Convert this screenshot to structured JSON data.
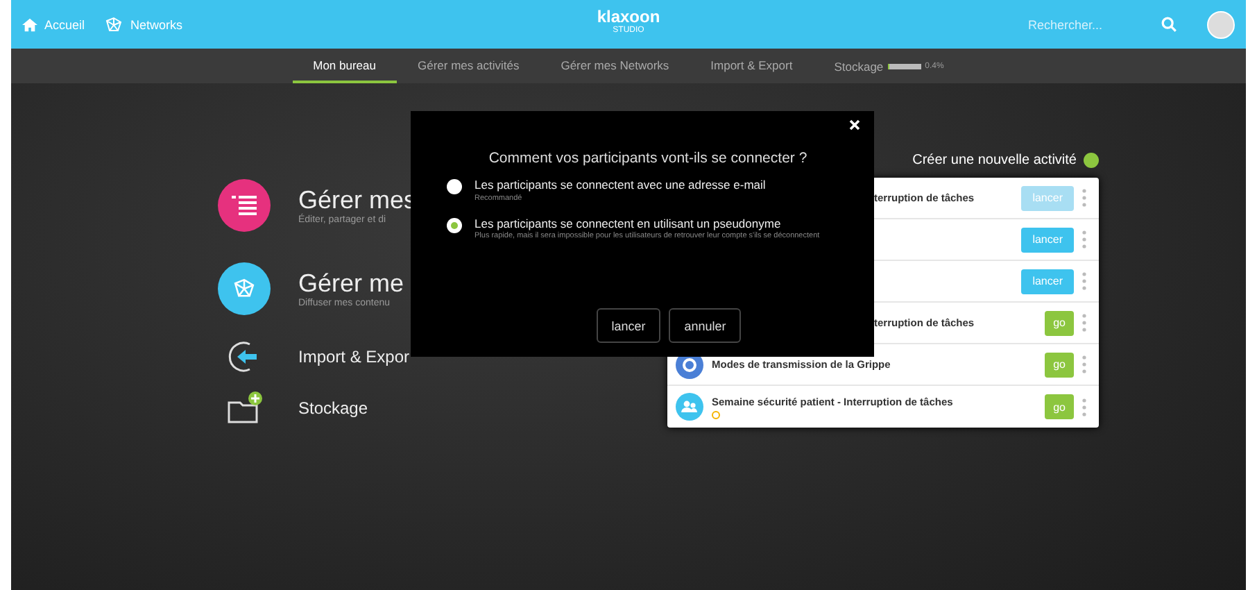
{
  "topbar": {
    "links": [
      {
        "label": "Accueil",
        "kind": "home"
      },
      {
        "label": "Networks",
        "kind": "network"
      }
    ],
    "logo": {
      "name": "klaxoon",
      "sub": "STUDIO"
    },
    "search": {
      "placeholder": "Rechercher..."
    }
  },
  "subnav": {
    "tabs": [
      {
        "label": "Mon bureau",
        "selected": true
      },
      {
        "label": "Gérer mes activités",
        "selected": false
      },
      {
        "label": "Gérer mes Networks",
        "selected": false
      },
      {
        "label": "Import & Export",
        "selected": false
      }
    ],
    "storage": {
      "label": "Stockage",
      "level": 0.004,
      "reading": "0.4%"
    }
  },
  "menu": [
    {
      "kind": "big",
      "title": "Gérer mes",
      "subtitle": "Éditer, partager et di"
    },
    {
      "kind": "big",
      "title": "Gérer me",
      "subtitle": "Diffuser mes contenu"
    },
    {
      "kind": "small",
      "title": "Import & Expor"
    },
    {
      "kind": "small",
      "title": "Stockage"
    }
  ],
  "activities": {
    "create": "Créer une nouvelle activité",
    "rows": [
      {
        "kind": "covered",
        "title": "terruption de tâches",
        "button": {
          "label": "lancer",
          "kind": "launch",
          "disabled": true
        },
        "badge": false
      },
      {
        "kind": "covered",
        "button": {
          "label": "lancer",
          "kind": "launch",
          "disabled": false
        },
        "badge": false
      },
      {
        "kind": "covered",
        "button": {
          "label": "lancer",
          "kind": "launch",
          "disabled": false
        },
        "badge": false
      },
      {
        "kind": "covered",
        "title": "terruption de tâches",
        "button": {
          "label": "go",
          "kind": "go",
          "disabled": false
        },
        "badge": false
      },
      {
        "kind": "ring",
        "title": "Modes de transmission de la Grippe",
        "button": {
          "label": "go",
          "kind": "go",
          "disabled": false
        },
        "badge": false
      },
      {
        "kind": "people",
        "title": "Semaine sécurité patient - Interruption de tâches",
        "button": {
          "label": "go",
          "kind": "go",
          "disabled": false
        },
        "badge": true
      }
    ]
  },
  "dialog": {
    "title": "Comment vos participants vont-ils se connecter ?",
    "options": [
      {
        "label": "Les participants se connectent avec une adresse e-mail",
        "hint": "Recommandé",
        "selected": false
      },
      {
        "label": "Les participants se connectent en utilisant un pseudonyme",
        "hint": "Plus rapide, mais il sera impossible pour les utilisateurs de retrouver leur compte s'ils se déconnectent",
        "selected": true
      }
    ],
    "buttons": [
      "lancer",
      "annuler"
    ]
  }
}
